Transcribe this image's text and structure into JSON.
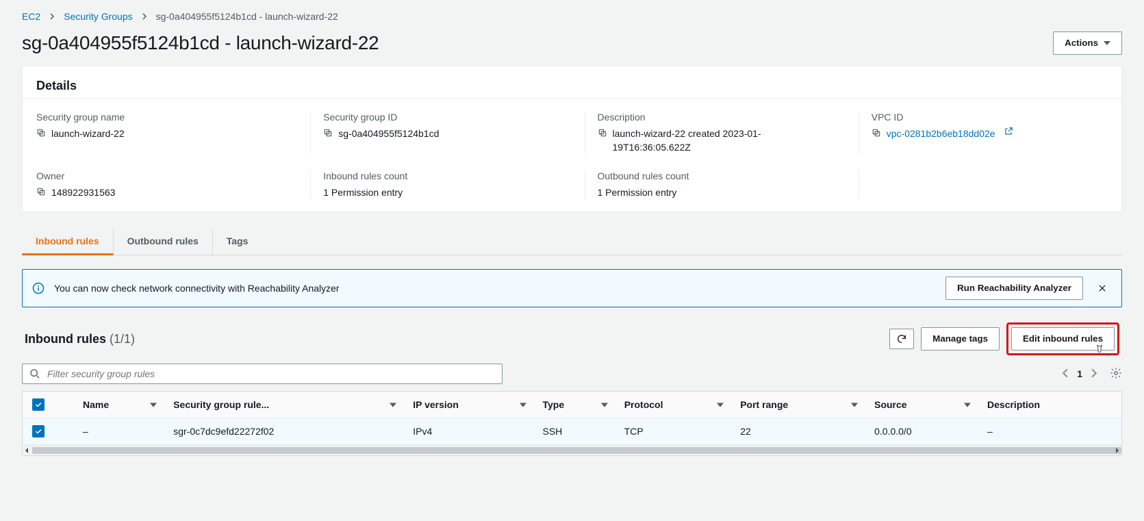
{
  "breadcrumb": [
    {
      "label": "EC2",
      "href": true
    },
    {
      "label": "Security Groups",
      "href": true
    },
    {
      "label": "sg-0a404955f5124b1cd - launch-wizard-22",
      "href": false
    }
  ],
  "title": "sg-0a404955f5124b1cd - launch-wizard-22",
  "actions_btn": "Actions",
  "details": {
    "heading": "Details",
    "fields": [
      {
        "label": "Security group name",
        "value": "launch-wizard-22",
        "copy": true
      },
      {
        "label": "Security group ID",
        "value": "sg-0a404955f5124b1cd",
        "copy": true
      },
      {
        "label": "Description",
        "value": "launch-wizard-22 created 2023-01-19T16:36:05.622Z",
        "copy": true
      },
      {
        "label": "VPC ID",
        "value": "vpc-0281b2b6eb18dd02e",
        "copy": true,
        "link": true,
        "ext": true
      },
      {
        "label": "Owner",
        "value": "148922931563",
        "copy": true
      },
      {
        "label": "Inbound rules count",
        "value": "1 Permission entry"
      },
      {
        "label": "Outbound rules count",
        "value": "1 Permission entry"
      }
    ],
    "fields_8_key": "empty"
  },
  "tabs": [
    "Inbound rules",
    "Outbound rules",
    "Tags"
  ],
  "active_tab": 0,
  "banner": {
    "msg": "You can now check network connectivity with Reachability Analyzer",
    "btn": "Run Reachability Analyzer"
  },
  "section": {
    "title": "Inbound rules",
    "count": "(1/1)",
    "refresh_label": "",
    "manage_tags": "Manage tags",
    "edit": "Edit inbound rules"
  },
  "filter": {
    "placeholder": "Filter security group rules"
  },
  "pager": {
    "page": "1"
  },
  "table": {
    "columns": [
      "Name",
      "Security group rule...",
      "IP version",
      "Type",
      "Protocol",
      "Port range",
      "Source",
      "Description"
    ],
    "rows": [
      {
        "selected": true,
        "cells": [
          "–",
          "sgr-0c7dc9efd22272f02",
          "IPv4",
          "SSH",
          "TCP",
          "22",
          "0.0.0.0/0",
          "–"
        ]
      }
    ]
  }
}
